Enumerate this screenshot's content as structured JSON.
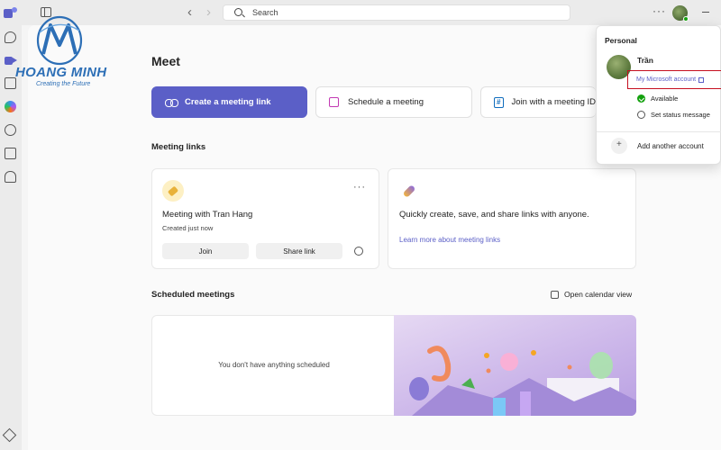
{
  "topbar": {
    "search_placeholder": "Search",
    "more_label": "···"
  },
  "logo": {
    "name": "HOANG MINH",
    "tagline": "Creating the Future"
  },
  "main": {
    "title": "Meet",
    "actions": [
      {
        "label": "Create a meeting link"
      },
      {
        "label": "Schedule a meeting"
      },
      {
        "label": "Join with a meeting ID"
      }
    ],
    "meeting_links_title": "Meeting links",
    "meeting_card": {
      "title": "Meeting with Tran Hang",
      "subtitle": "Created just now",
      "join_label": "Join",
      "share_label": "Share link",
      "more_label": "···"
    },
    "promo_card": {
      "text": "Quickly create, save, and share links with anyone.",
      "link": "Learn more about meeting links"
    },
    "scheduled_title": "Scheduled meetings",
    "calendar_link": "Open calendar view",
    "empty_text": "You don't have anything scheduled"
  },
  "flyout": {
    "section": "Personal",
    "name": "Trần",
    "account_link": "My Microsoft account",
    "status": "Available",
    "status_message": "Set status message",
    "add_account": "Add another account"
  },
  "colors": {
    "accent": "#5b5fc7",
    "available": "#13a10e",
    "highlight_box": "#c50f1f",
    "logo_blue": "#2d6fb6"
  }
}
